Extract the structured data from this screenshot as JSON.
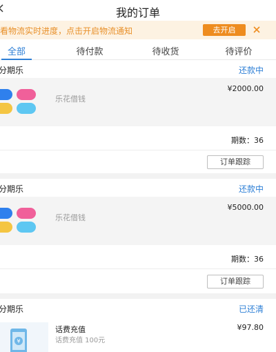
{
  "header": {
    "title": "我的订单"
  },
  "notice": {
    "text": "看物流实时进度，点击开启物流通知",
    "button_label": "去开启",
    "colors": {
      "background": "#fdf2e2",
      "text": "#e8902a",
      "button": "#ee8c1f"
    }
  },
  "tabs": [
    {
      "label": "全部",
      "active": true
    },
    {
      "label": "待付款",
      "active": false
    },
    {
      "label": "待收货",
      "active": false
    },
    {
      "label": "待评价",
      "active": false
    }
  ],
  "orders": [
    {
      "shop": "分期乐",
      "status": "还款中",
      "item_name": "乐花借钱",
      "price": "¥2000.00",
      "periods": "期数：36",
      "action": "订单跟踪"
    },
    {
      "shop": "分期乐",
      "status": "还款中",
      "item_name": "乐花借钱",
      "price": "¥5000.00",
      "periods": "期数：36",
      "action": "订单跟踪"
    },
    {
      "shop": "分期乐",
      "status": "已还清",
      "item_name": "话费充值",
      "item_sub": "话费充值 100元",
      "price": "¥97.80"
    }
  ],
  "colors": {
    "accent": "#2d7fd6",
    "logo": [
      "#2f80ed",
      "#f0609a",
      "#f4c542",
      "#5ec7f2"
    ]
  }
}
